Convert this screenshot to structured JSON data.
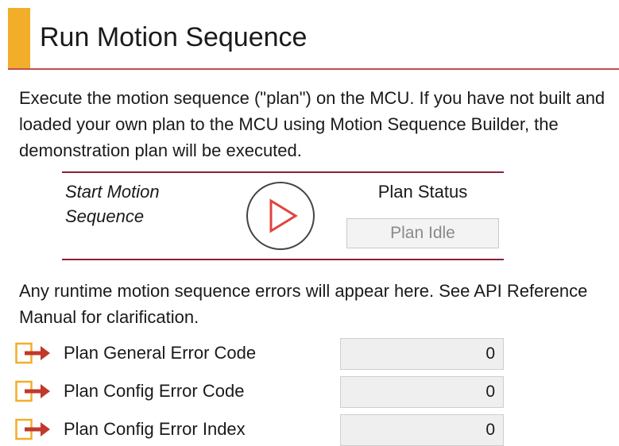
{
  "header": {
    "title": "Run Motion Sequence",
    "accent_color": "#f2ae2a",
    "rule_color": "#c0504d"
  },
  "description": "Execute the motion sequence (\"plan\") on the MCU. If you have not built and loaded your own plan to the MCU using Motion Sequence Builder, the demonstration plan will be executed.",
  "control_panel": {
    "start_label_line1": "Start Motion",
    "start_label_line2": "Sequence",
    "play_icon": "play-icon",
    "status_title": "Plan Status",
    "status_value": "Plan Idle",
    "rule_color": "#8e1f3a"
  },
  "errors": {
    "description": "Any runtime motion sequence errors will appear here. See API Reference Manual for clarification.",
    "icon": "arrow-right-icon",
    "rows": [
      {
        "label": "Plan General Error Code",
        "value": "0"
      },
      {
        "label": "Plan Config Error Code",
        "value": "0"
      },
      {
        "label": "Plan Config Error Index",
        "value": "0"
      }
    ]
  }
}
